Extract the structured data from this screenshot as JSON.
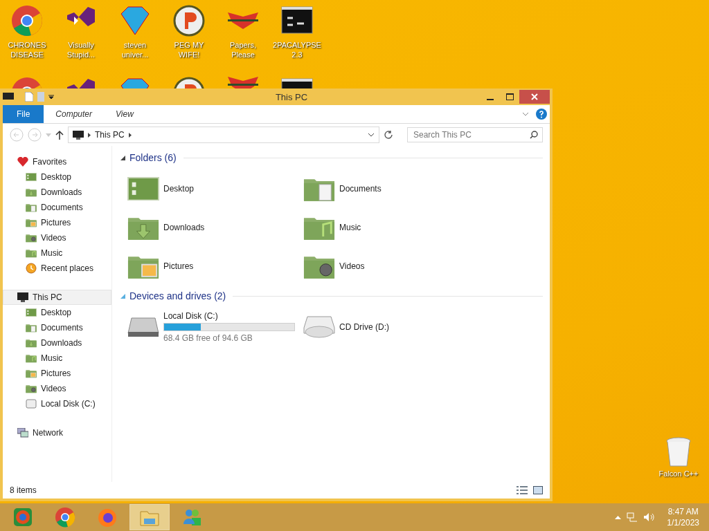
{
  "desktop_icons": [
    {
      "label": "CHRONES DISEASE",
      "kind": "chrome"
    },
    {
      "label": "Visually Stupid...",
      "kind": "studio"
    },
    {
      "label": "steven univer...",
      "kind": "gem"
    },
    {
      "label": "PEG MY WIFE!",
      "kind": "peg"
    },
    {
      "label": "Papers, Please",
      "kind": "eagle"
    },
    {
      "label": "2PACALYPSE 2.3",
      "kind": "console"
    }
  ],
  "recycle_bin": {
    "label": "Falcon C++"
  },
  "window": {
    "title": "This PC",
    "ribbon_tabs": [
      {
        "label": "File",
        "selected": true
      },
      {
        "label": "Computer",
        "selected": false
      },
      {
        "label": "View",
        "selected": false
      }
    ],
    "address": {
      "path": "This PC"
    },
    "search": {
      "placeholder": "Search This PC"
    },
    "sidebar": {
      "items": [
        {
          "label": "Favorites",
          "kind": "favorites",
          "selected": false,
          "children": [
            {
              "label": "Desktop",
              "kind": "desktop",
              "selected": false
            },
            {
              "label": "Downloads",
              "kind": "downloads",
              "selected": false
            },
            {
              "label": "Documents",
              "kind": "documents",
              "selected": false
            },
            {
              "label": "Pictures",
              "kind": "pictures",
              "selected": false
            },
            {
              "label": "Videos",
              "kind": "videos",
              "selected": false
            },
            {
              "label": "Music",
              "kind": "music",
              "selected": false
            },
            {
              "label": "Recent places",
              "kind": "recent",
              "selected": false
            }
          ]
        },
        {
          "label": "This PC",
          "kind": "pc",
          "selected": true,
          "children": [
            {
              "label": "Desktop",
              "kind": "desktop",
              "selected": false
            },
            {
              "label": "Documents",
              "kind": "documents",
              "selected": false
            },
            {
              "label": "Downloads",
              "kind": "downloads",
              "selected": false
            },
            {
              "label": "Music",
              "kind": "music",
              "selected": false
            },
            {
              "label": "Pictures",
              "kind": "pictures",
              "selected": false
            },
            {
              "label": "Videos",
              "kind": "videos",
              "selected": false
            },
            {
              "label": "Local Disk (C:)",
              "kind": "disk",
              "selected": false
            }
          ]
        },
        {
          "label": "Network",
          "kind": "network",
          "selected": false
        }
      ]
    },
    "sections": [
      {
        "heading": "Folders (6)",
        "items": [
          {
            "label": "Desktop",
            "kind": "desktop"
          },
          {
            "label": "Documents",
            "kind": "documents"
          },
          {
            "label": "Downloads",
            "kind": "downloads"
          },
          {
            "label": "Music",
            "kind": "music"
          },
          {
            "label": "Pictures",
            "kind": "pictures"
          },
          {
            "label": "Videos",
            "kind": "videos"
          }
        ]
      },
      {
        "heading": "Devices and drives (2)",
        "items": [
          {
            "label": "Local Disk (C:)",
            "kind": "disk",
            "level": 0.28,
            "caption": "68.4 GB free of 94.6 GB"
          },
          {
            "label": "CD Drive (D:)",
            "kind": "cd"
          }
        ]
      }
    ],
    "status_bar": {
      "text": "8 items"
    }
  },
  "taskbar": {
    "apps": [
      {
        "kind": "chromium",
        "selected": false
      },
      {
        "kind": "chrome",
        "selected": false
      },
      {
        "kind": "firefox",
        "selected": false
      },
      {
        "kind": "explorer",
        "selected": true
      },
      {
        "kind": "messenger",
        "selected": false
      }
    ],
    "clock": {
      "time": "8:47 AM",
      "date": "1/1/2023"
    }
  }
}
